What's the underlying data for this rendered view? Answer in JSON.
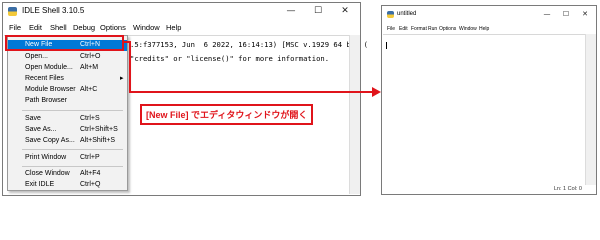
{
  "shell": {
    "title": "IDLE Shell 3.10.5",
    "controls": {
      "minimize": "—",
      "maximize": "☐",
      "close": "✕"
    },
    "menu": [
      "File",
      "Edit",
      "Shell",
      "Debug",
      "Options",
      "Window",
      "Help"
    ],
    "lines": [
      ".5:f377153, Jun  6 2022, 16:14:13) [MSC v.1929 64 bit (",
      "\"credits\" or \"license()\" for more information."
    ]
  },
  "file_menu": {
    "items": [
      {
        "label": "New File",
        "shortcut": "Ctrl+N",
        "highlighted": true
      },
      {
        "label": "Open...",
        "shortcut": "Ctrl+O"
      },
      {
        "label": "Open Module...",
        "shortcut": "Alt+M"
      },
      {
        "label": "Recent Files",
        "shortcut": "",
        "submenu": "▸"
      },
      {
        "label": "Module Browser",
        "shortcut": "Alt+C"
      },
      {
        "label": "Path Browser",
        "shortcut": ""
      },
      {
        "label": "Save",
        "shortcut": "Ctrl+S"
      },
      {
        "label": "Save As...",
        "shortcut": "Ctrl+Shift+S"
      },
      {
        "label": "Save Copy As...",
        "shortcut": "Alt+Shift+S"
      },
      {
        "label": "Print Window",
        "shortcut": "Ctrl+P"
      },
      {
        "label": "Close Window",
        "shortcut": "Alt+F4"
      },
      {
        "label": "Exit IDLE",
        "shortcut": "Ctrl+Q"
      }
    ]
  },
  "annotation": {
    "text": "[New File] でエディタウィンドウが開く",
    "color": "#e0141b"
  },
  "untitled": {
    "title": "untitled",
    "controls": {
      "minimize": "—",
      "maximize": "☐",
      "close": "✕"
    },
    "menu": [
      "File",
      "Edit",
      "Format",
      "Run",
      "Options",
      "Window",
      "Help"
    ],
    "status": "Ln: 1   Col: 0"
  },
  "colors": {
    "accent": "#0078d7",
    "annotation": "#e0141b"
  }
}
